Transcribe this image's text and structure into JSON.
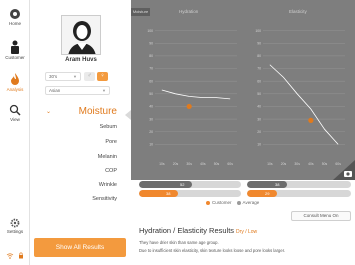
{
  "nav": {
    "home": "Home",
    "customer": "Customer",
    "analysis": "Analysis",
    "view": "View",
    "settings": "Settings"
  },
  "profile": {
    "name": "Aram Huvs",
    "age": "30's",
    "area": "Asian"
  },
  "categories": {
    "heading": "Moisture",
    "items": [
      "Sebum",
      "Pore",
      "Melanin",
      "COP",
      "Wrinkle",
      "Sensitivity"
    ]
  },
  "buttons": {
    "show_all": "Show All Results",
    "comment": "Consult Menu On"
  },
  "chart": {
    "corner_tab": "Moisture",
    "left_title": "Hydration",
    "right_title": "Elasticity",
    "y_ticks": [
      "100",
      "90",
      "80",
      "70",
      "60",
      "50",
      "40",
      "30",
      "20",
      "10"
    ],
    "x_ticks": [
      "10s",
      "20s",
      "30s",
      "40s",
      "50s",
      "60s"
    ]
  },
  "chart_data": [
    {
      "type": "line",
      "title": "Hydration",
      "x": [
        "10s",
        "20s",
        "30s",
        "40s",
        "50s",
        "60s"
      ],
      "series": [
        {
          "values": [
            53,
            50,
            48,
            47,
            47,
            46
          ]
        }
      ],
      "point": {
        "x": "30s",
        "y": 40
      },
      "ylim": [
        0,
        110
      ]
    },
    {
      "type": "line",
      "title": "Elasticity",
      "x": [
        "10s",
        "20s",
        "30s",
        "40s",
        "50s",
        "60s"
      ],
      "series": [
        {
          "values": [
            73,
            63,
            50,
            38,
            22,
            10
          ]
        }
      ],
      "point": {
        "x": "40s",
        "y": 29
      },
      "ylim": [
        0,
        110
      ]
    }
  ],
  "bars": {
    "left_avg": "52",
    "left_cust": "38",
    "right_avg": "38",
    "right_cust": "29",
    "left_avg_fraction": 0.52,
    "left_cust_fraction": 0.38,
    "right_avg_fraction": 0.38,
    "right_cust_fraction": 0.29
  },
  "legend": {
    "customer": "Customer",
    "average": "Average"
  },
  "result": {
    "title": "Hydration / Elasticity Results",
    "tag": "Dry / Low",
    "line1": "They have drier skin than same age group.",
    "line2": "Due to insufficient skin elasticity, skin texture looks loose and pore looks larger."
  },
  "colors": {
    "accent": "#e07a1d",
    "button": "#f39a3e",
    "average_bar": "#6d6d6d",
    "customer_bar": "#f0882e",
    "panel": "#7e7e7e"
  }
}
